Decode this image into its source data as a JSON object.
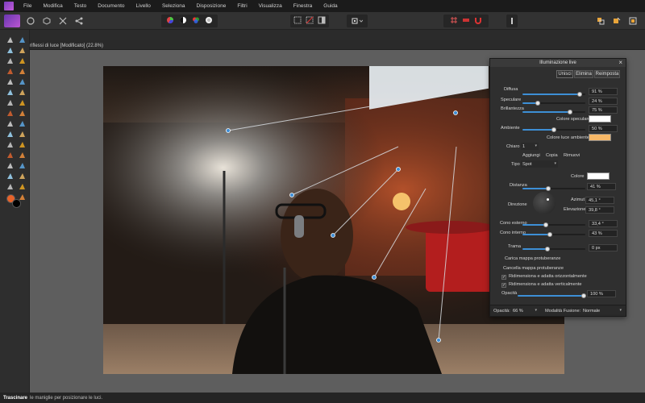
{
  "menu": {
    "items": [
      "File",
      "Modifica",
      "Testo",
      "Documento",
      "Livello",
      "Seleziona",
      "Disposizione",
      "Filtri",
      "Visualizza",
      "Finestra",
      "Guida"
    ]
  },
  "document": {
    "title": "riflessi di luce [Modificato] (22.8%)"
  },
  "panel": {
    "title": "Illuminazione live",
    "buttons": {
      "unisci": "Unisci",
      "elimina": "Elimina",
      "reimposta": "Reimposta"
    },
    "diffusa": {
      "label": "Diffusa",
      "value": "91 %",
      "fraction": 0.91
    },
    "speculare": {
      "label": "Speculare",
      "value": "24 %",
      "fraction": 0.24
    },
    "brillantezza": {
      "label": "Brillantezza",
      "value": "75 %",
      "fraction": 0.75
    },
    "colore_speculare": {
      "label": "Colore speculare",
      "color": "#ffffff"
    },
    "ambiente": {
      "label": "Ambiente",
      "value": "50 %",
      "fraction": 0.5
    },
    "colore_luce_ambiente": {
      "label": "Colore luce ambiente",
      "color": "#f7b867"
    },
    "chiaro": {
      "label": "Chiaro",
      "value": "1"
    },
    "aggiungi": "Aggiungi",
    "copia": "Copia",
    "rimuovi": "Rimuovi",
    "tipo": {
      "label": "Tipo",
      "value": "Spot"
    },
    "colore": {
      "label": "Colore",
      "color": "#ffffff"
    },
    "distanza": {
      "label": "Distanza",
      "value": "41 %",
      "fraction": 0.41
    },
    "direzione": {
      "label": "Direzione"
    },
    "azimut": {
      "label": "Azimut",
      "value": "45,1 °"
    },
    "elevazione": {
      "label": "Elevazione",
      "value": "39,8 °"
    },
    "cono_esterno": {
      "label": "Cono esterno",
      "value": "33,4 °",
      "fraction": 0.37
    },
    "cono_interno": {
      "label": "Cono interno",
      "value": "43 %",
      "fraction": 0.43
    },
    "trama": {
      "label": "Trama",
      "value": "0 px",
      "fraction": 0.4
    },
    "carica_mappa": "Carica mappa protuberanze",
    "cancella_mappa": "Cancella mappa protuberanze",
    "ridim_orizz": {
      "label": "Ridimensiona e adatta orizzontalmente",
      "checked": true
    },
    "ridim_vert": {
      "label": "Ridimensiona e adatta verticalmente",
      "checked": true
    },
    "opacita_slider": {
      "label": "Opacità",
      "value": "100 %",
      "fraction": 1.0
    },
    "footer": {
      "opacita_label": "Opacità:",
      "opacita_value": "66 %",
      "blend_label": "Modalità Fusione:",
      "blend_value": "Normale"
    }
  },
  "status": {
    "bold": "Trascinare",
    "text": "le maniglie per posizionare le luci."
  }
}
